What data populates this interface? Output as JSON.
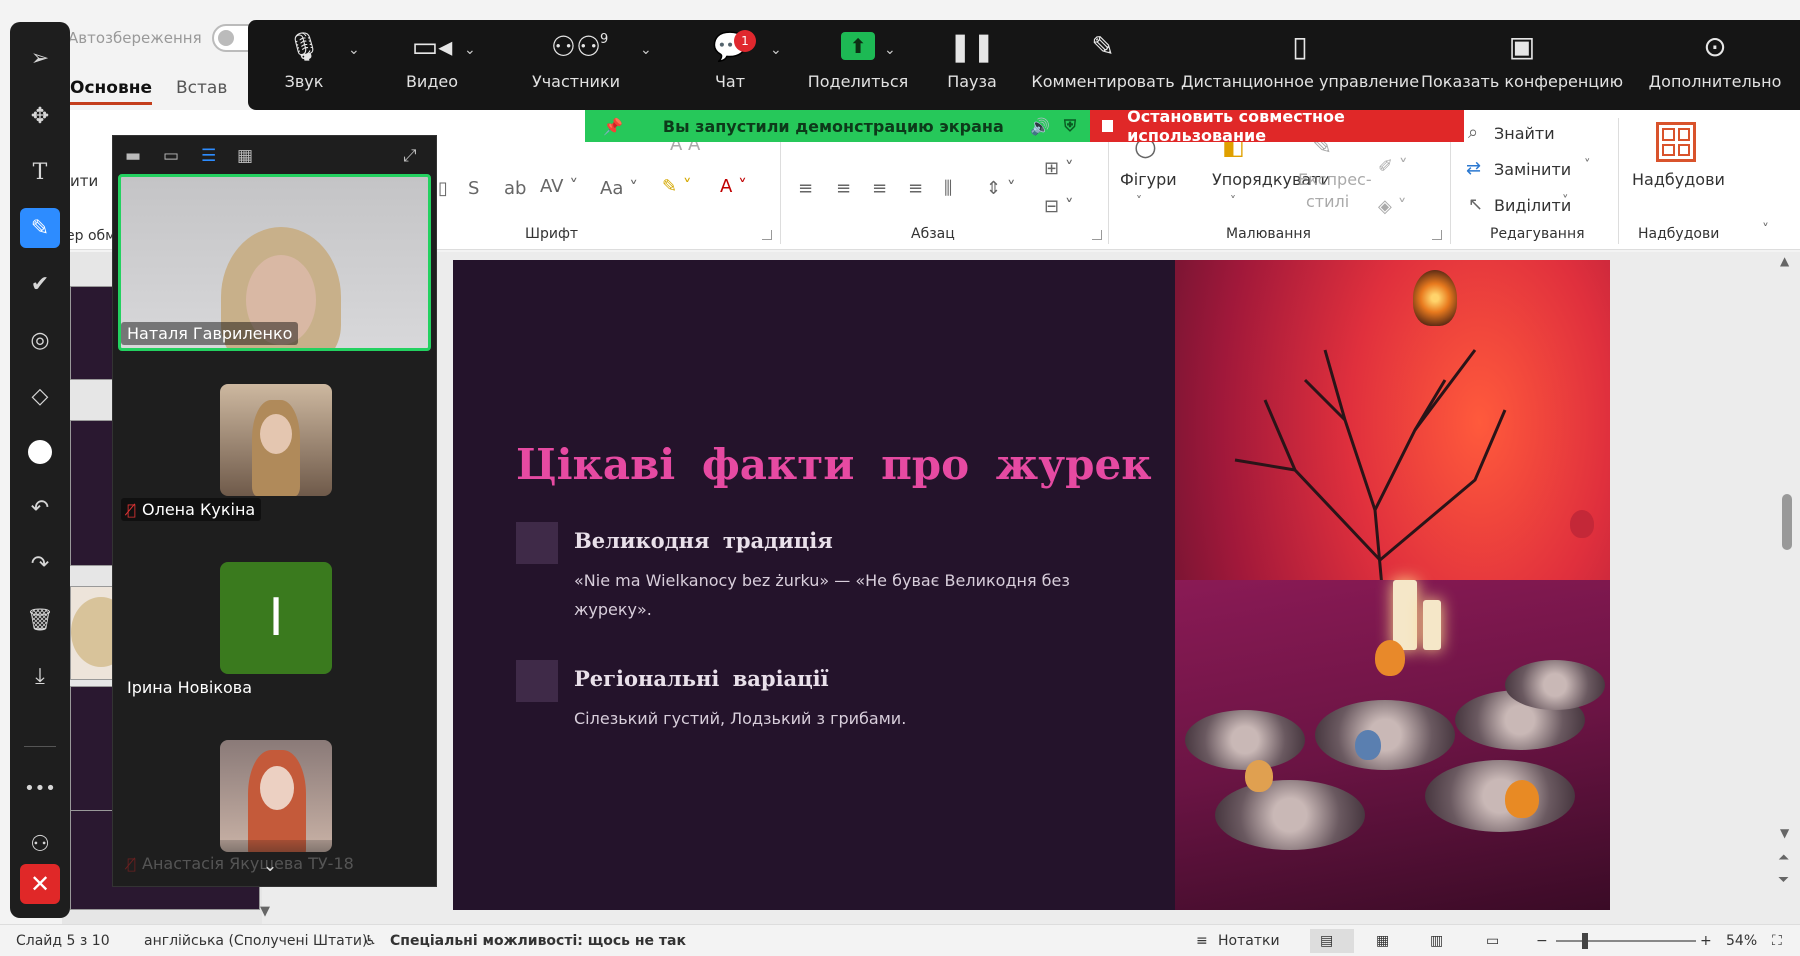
{
  "powerpoint": {
    "autosave_label": "Автозбереження",
    "tabs": [
      "Основне",
      "Встав"
    ],
    "clipped_text": {
      "paste": "ити",
      "clipboard": "ер обм"
    },
    "groups": {
      "font": "Шрифт",
      "paragraph": "Абзац",
      "drawing": "Малювання",
      "editing": "Редагування",
      "addins": "Надбудови"
    },
    "drawing_buttons": {
      "shapes": "Фігури",
      "arrange": "Упорядкувати",
      "quick_styles_1": "Експрес-",
      "quick_styles_2": "стилі"
    },
    "editing_buttons": {
      "find": "Знайти",
      "replace": "Замінити",
      "select": "Виділити"
    },
    "addins_button": "Надбудови"
  },
  "slide": {
    "title": "Цікаві факти про журек",
    "items": [
      {
        "title": "Великодня традиція",
        "text": "«Nie ma Wielkanocy bez żurku» — «Не буває Великодня без журеку»."
      },
      {
        "title": "Регіональні варіації",
        "text": "Сілезький густий, Лодзький з грибами."
      }
    ]
  },
  "status_bar": {
    "slide_counter": "Слайд 5 з 10",
    "language": "англійська (Сполучені Штати)",
    "accessibility": "Спеціальні можливості: щось не так",
    "notes": "Нотатки",
    "zoom": "54%"
  },
  "zoom_bar": {
    "items": [
      {
        "label": "Звук",
        "icon": "microphone-icon"
      },
      {
        "label": "Видео",
        "icon": "video-camera-icon"
      },
      {
        "label": "Участники",
        "icon": "participants-icon",
        "count": "9"
      },
      {
        "label": "Чат",
        "icon": "chat-icon",
        "badge": "1"
      },
      {
        "label": "Поделиться",
        "icon": "share-screen-icon"
      },
      {
        "label": "Пауза",
        "icon": "pause-icon"
      },
      {
        "label": "Комментировать",
        "icon": "annotate-pencil-icon"
      },
      {
        "label": "Дистанционное управление",
        "icon": "mouse-icon"
      },
      {
        "label": "Показать конференцию",
        "icon": "show-meeting-icon"
      },
      {
        "label": "Дополнительно",
        "icon": "more-icon"
      }
    ],
    "share_banner": "Вы запустили демонстрацию экрана",
    "stop_banner": "Остановить совместное использование",
    "colors": {
      "bar": "#151515",
      "share_green": "#26c85a",
      "stop_red": "#e02828",
      "badge_red": "#e0282e"
    }
  },
  "gallery": {
    "participants": [
      {
        "name": "Наталя Гавриленко",
        "muted": false,
        "active_speaker": true
      },
      {
        "name": "Олена Кукіна",
        "muted": true
      },
      {
        "name": "Ірина Новікова",
        "initial": "І",
        "avatar_color": "#3a7a1e"
      },
      {
        "name": "Анастасія Якушева ТУ-18",
        "muted": true
      }
    ]
  },
  "annotation_tools": [
    "select-arrow-icon",
    "move-icon",
    "text-icon",
    "draw-pencil-icon",
    "stamp-check-icon",
    "spotlight-icon",
    "eraser-icon",
    "color-circle-icon",
    "undo-icon",
    "redo-icon",
    "trash-icon",
    "save-download-icon",
    "more-dots-icon",
    "participant-annotate-icon",
    "close-icon"
  ]
}
